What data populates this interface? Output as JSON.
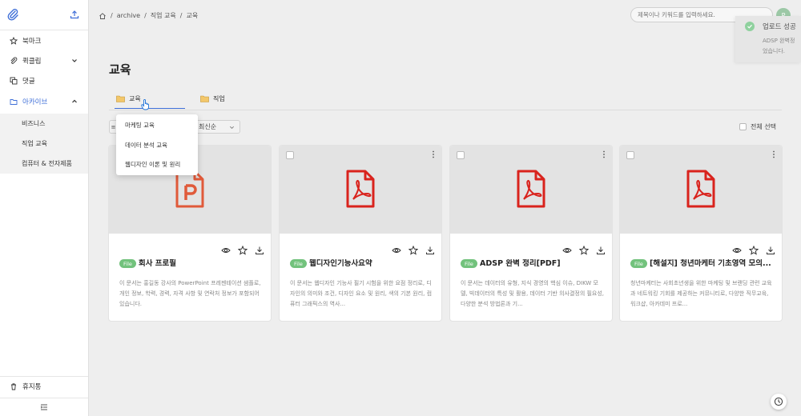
{
  "sidebar": {
    "items": [
      {
        "label": "북마크",
        "icon": "star-icon"
      },
      {
        "label": "퀵클립",
        "icon": "paperclip-icon"
      },
      {
        "label": "댓글",
        "icon": "comment-icon"
      },
      {
        "label": "아카이브",
        "icon": "folder-icon"
      }
    ],
    "archive_sub": [
      "비즈니스",
      "직업 교육",
      "컴퓨터 & 전자제품"
    ],
    "trash": "휴지통"
  },
  "breadcrumb": {
    "items": [
      "archive",
      "직업 교육",
      "교육"
    ],
    "sep": "/"
  },
  "search": {
    "placeholder": "제목이나 키워드를 입력하세요."
  },
  "avatar": {
    "initial": "P"
  },
  "toast": {
    "title": "업로드 성공",
    "body_line1": "ADSP 완벽정",
    "body_line2": "었습니다."
  },
  "page": {
    "title": "교육"
  },
  "folder_tabs": [
    {
      "label": "교육"
    },
    {
      "label": "직업"
    }
  ],
  "sort": {
    "value": "최신순",
    "left_glyph": "≡"
  },
  "select_all": "전체 선택",
  "menu": {
    "items": [
      "마케팅 교육",
      "데이터 분석 교육",
      "웹디자인 이론 및 원리"
    ]
  },
  "cards": [
    {
      "badge": "File",
      "title": "회사 프로필",
      "desc": "이 문서는 홍길동 강사의 PowerPoint 프레젠테이션 샘플로, 개인 정보, 학력, 경력, 자격 사항 및 연락처 정보가 포함되어 있습니다.",
      "type": "ppt"
    },
    {
      "badge": "File",
      "title": "웹디자인기능사요약",
      "desc": "이 문서는 웹디자인 기능사 필기 시험을 위한 요점 정리로, 디자인의 의미와 조건, 디자인 요소 및 원리, 색의 기본 원리, 컴퓨터 그래픽스의 역사...",
      "type": "pdf"
    },
    {
      "badge": "File",
      "title": "ADSP 완벽 정리[PDF]",
      "desc": "이 문서는 데이터의 유형, 지식 경영의 핵심 이슈, DIKW 모델, 빅데이터의 특성 및 활용, 데이터 기반 의사결정의 필요성, 다양한 분석 방법론과 기...",
      "type": "pdf"
    },
    {
      "badge": "File",
      "title": "[해설지] 청년마케터 기초영역 모의...",
      "desc": "청년마케터는 사회초년생을 위한 마케팅 및 브랜딩 관련 교육과 네트워킹 기회를 제공하는 커뮤니티로, 다양한 직무교육, 워크샵, 아카데미 프로...",
      "type": "pdf"
    }
  ],
  "colors": {
    "accent": "#3f6fd8",
    "pdf": "#d9231d",
    "ppt": "#e05a3a",
    "badge": "#72c27c"
  }
}
